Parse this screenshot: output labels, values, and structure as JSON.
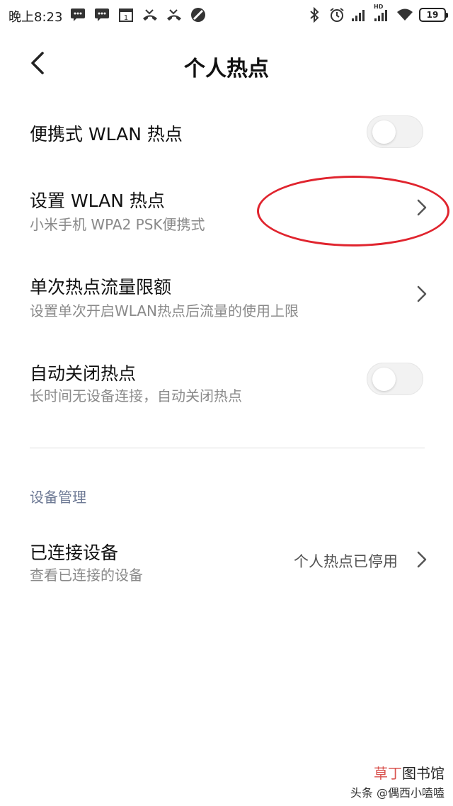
{
  "status_bar": {
    "time": "晚上8:23",
    "notification_icons": [
      "message-icon",
      "message-icon",
      "calendar-icon",
      "missed-call-icon",
      "missed-call-icon",
      "dnd-icon"
    ],
    "calendar_day": "1",
    "right_icons": [
      "bluetooth-icon",
      "alarm-icon",
      "signal-icon",
      "hd-signal-icon",
      "wifi-icon",
      "battery-icon"
    ],
    "hd_label": "HD",
    "battery_level": "19"
  },
  "header": {
    "title": "个人热点"
  },
  "settings": {
    "portable_hotspot": {
      "title": "便携式 WLAN 热点",
      "enabled": false
    },
    "setup_hotspot": {
      "title": "设置 WLAN 热点",
      "subtitle": "小米手机 WPA2 PSK便携式"
    },
    "data_limit": {
      "title": "单次热点流量限额",
      "subtitle": "设置单次开启WLAN热点后流量的使用上限"
    },
    "auto_off": {
      "title": "自动关闭热点",
      "subtitle": "长时间无设备连接，自动关闭热点",
      "enabled": false
    }
  },
  "device_section": {
    "header": "设备管理",
    "connected_devices": {
      "title": "已连接设备",
      "subtitle": "查看已连接的设备",
      "value": "个人热点已停用"
    }
  },
  "annotation_color": "#e0242e",
  "watermark": {
    "brand_part1": "草丁",
    "brand_part2": "图书馆",
    "author": "头条 @偶西小嗑嗑"
  }
}
